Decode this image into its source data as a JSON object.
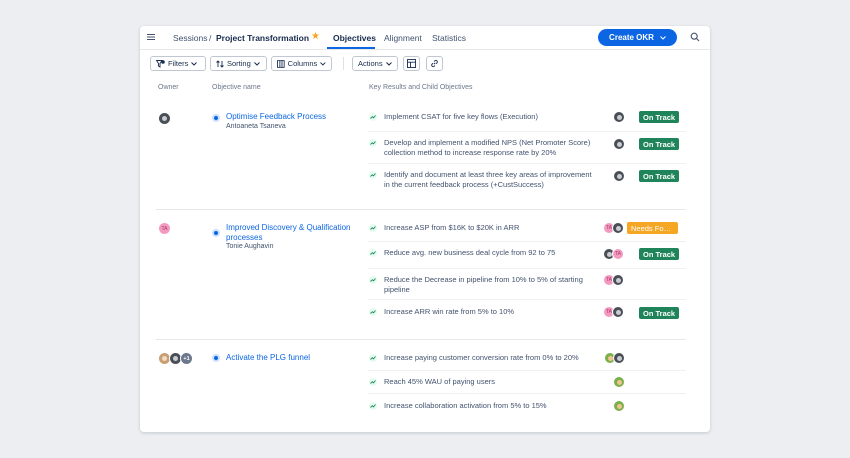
{
  "header": {
    "breadcrumb_root": "Sessions",
    "breadcrumb_sep": "/",
    "breadcrumb_title": "Project Transformation",
    "tabs": [
      {
        "label": "Objectives"
      },
      {
        "label": "Alignment"
      },
      {
        "label": "Statistics"
      }
    ],
    "create_label": "Create OKR"
  },
  "toolbar": {
    "filters_label": "Filters",
    "filters_count": "1",
    "sorting_label": "Sorting",
    "columns_label": "Columns",
    "actions_label": "Actions"
  },
  "columns": {
    "owner": "Owner",
    "objective": "Objective name",
    "key_results": "Key Results and Child Objectives"
  },
  "objectives": [
    {
      "name": "Optimise Feedback Process",
      "owner": "Antoaneta Tsaneva",
      "key_results": [
        {
          "text": "Implement CSAT for five key flows (Execution)",
          "status": "On Track"
        },
        {
          "text": "Develop and implement a modified NPS (Net Promoter Score) collection method to increase response rate by 20%",
          "status": "On Track"
        },
        {
          "text": "Identify and document at least three key areas of improvement in the current feedback process (+CustSuccess)",
          "status": "On Track"
        }
      ]
    },
    {
      "name": "Improved Discovery & Qualification processes",
      "owner": "Tonie Aughavin",
      "owner_initials": "TA",
      "key_results": [
        {
          "text": "Increase ASP from $16K to $20K in ARR",
          "status": "Needs Fo…",
          "initials": "TA"
        },
        {
          "text": "Reduce avg. new business deal cycle from 92 to 75",
          "status": "On Track",
          "initials": "TA"
        },
        {
          "text": "Reduce the Decrease in pipeline from 10% to 5% of starting pipeline",
          "initials": "TA"
        },
        {
          "text": "Increase ARR win rate from 5% to 10%",
          "status": "On Track",
          "initials": "TA"
        }
      ]
    },
    {
      "name": "Activate the PLG funnel",
      "owner_extra": "+1",
      "key_results": [
        {
          "text": "Increase paying customer conversion rate from 0% to 20%"
        },
        {
          "text": "Reach 45% WAU of paying users"
        },
        {
          "text": "Increase collaboration activation from 5% to 15%"
        }
      ]
    }
  ],
  "colors": {
    "accent": "#0c66e4",
    "on_track": "#1f845a",
    "needs_focus": "#f5a623",
    "star": "#f5a623"
  }
}
